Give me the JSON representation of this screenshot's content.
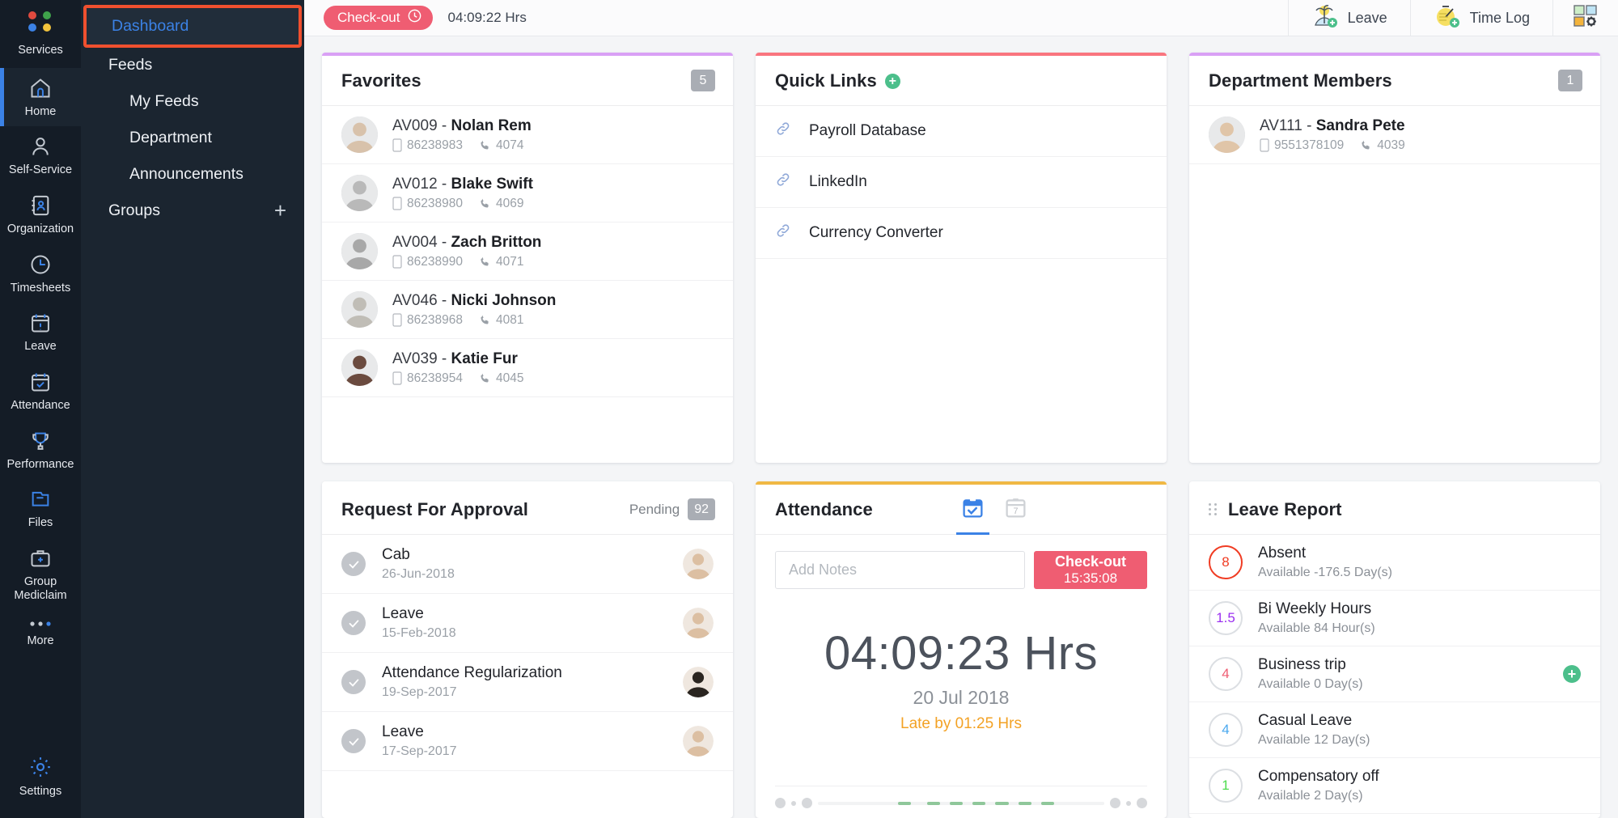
{
  "rail": {
    "items": [
      {
        "label": "Services",
        "icon": "dots-logo-icon",
        "active": false
      },
      {
        "label": "Home",
        "icon": "home-icon",
        "active": true
      },
      {
        "label": "Self-Service",
        "icon": "user-icon",
        "active": false
      },
      {
        "label": "Organization",
        "icon": "address-book-icon",
        "active": false
      },
      {
        "label": "Timesheets",
        "icon": "clock-icon",
        "active": false
      },
      {
        "label": "Leave",
        "icon": "calendar-alert-icon",
        "active": false
      },
      {
        "label": "Attendance",
        "icon": "calendar-check-icon",
        "active": false
      },
      {
        "label": "Performance",
        "icon": "trophy-icon",
        "active": false
      },
      {
        "label": "Files",
        "icon": "folder-icon",
        "active": false
      },
      {
        "label": "Group\nMediclaim",
        "icon": "briefcase-medical-icon",
        "active": false
      },
      {
        "label": "More",
        "icon": "ellipsis-icon",
        "active": false
      },
      {
        "label": "Settings",
        "icon": "gear-icon",
        "active": false
      }
    ]
  },
  "subnav": {
    "selected": "Dashboard",
    "items": [
      {
        "label": "Feeds",
        "indent": false,
        "plus": false
      },
      {
        "label": "My Feeds",
        "indent": true,
        "plus": false
      },
      {
        "label": "Department",
        "indent": true,
        "plus": false
      },
      {
        "label": "Announcements",
        "indent": true,
        "plus": false
      },
      {
        "label": "Groups",
        "indent": false,
        "plus": true
      }
    ]
  },
  "topbar": {
    "checkout_label": "Check-out",
    "hours": "04:09:22 Hrs",
    "leave_label": "Leave",
    "timelog_label": "Time Log"
  },
  "favorites": {
    "title": "Favorites",
    "count": "5",
    "accent": "#d9a0f5",
    "people": [
      {
        "code": "AV009 - ",
        "name": "Nolan Rem",
        "mobile": "86238983",
        "ext": "4074",
        "tone": "#d8c2ab"
      },
      {
        "code": "AV012 - ",
        "name": "Blake Swift",
        "mobile": "86238980",
        "ext": "4069",
        "tone": "#b9b9b9"
      },
      {
        "code": "AV004 - ",
        "name": "Zach Britton",
        "mobile": "86238990",
        "ext": "4071",
        "tone": "#a8a8a8"
      },
      {
        "code": "AV046 - ",
        "name": "Nicki Johnson",
        "mobile": "86238968",
        "ext": "4081",
        "tone": "#c0bdb6"
      },
      {
        "code": "AV039 - ",
        "name": "Katie Fur",
        "mobile": "86238954",
        "ext": "4045",
        "tone": "#6b4b3f"
      }
    ]
  },
  "quick_links": {
    "title": "Quick Links",
    "accent": "#f9757f",
    "links": [
      {
        "label": "Payroll Database"
      },
      {
        "label": "LinkedIn"
      },
      {
        "label": "Currency Converter"
      }
    ]
  },
  "department_members": {
    "title": "Department Members",
    "count": "1",
    "accent": "#d9a0f5",
    "people": [
      {
        "code": "AV111 - ",
        "name": "Sandra Pete",
        "mobile": "9551378109",
        "ext": "4039",
        "tone": "#e0c5a8"
      }
    ]
  },
  "approvals": {
    "title": "Request For Approval",
    "pending_label": "Pending",
    "pending_count": "92",
    "rows": [
      {
        "title": "Cab",
        "date": "26-Jun-2018",
        "tone": "#dcbfa2"
      },
      {
        "title": "Leave",
        "date": "15-Feb-2018",
        "tone": "#dcbfa2"
      },
      {
        "title": "Attendance Regularization",
        "date": "19-Sep-2017",
        "tone": "#2a2520"
      },
      {
        "title": "Leave",
        "date": "17-Sep-2017",
        "tone": "#dcbfa2"
      }
    ]
  },
  "attendance": {
    "title": "Attendance",
    "accent": "#f0b844",
    "tab_today_icon": "calendar-check-icon",
    "tab_week_icon": "calendar-7-icon",
    "notes_placeholder": "Add Notes",
    "checkout_label": "Check-out",
    "checkout_time": "15:35:08",
    "clock": "04:09:23 Hrs",
    "date": "20 Jul 2018",
    "late": "Late by 01:25 Hrs",
    "progress_segments": [
      28,
      38,
      46,
      54,
      62,
      70,
      78
    ]
  },
  "leave_report": {
    "title": "Leave Report",
    "rows": [
      {
        "value": "8",
        "name": "Absent",
        "sub": "Available -176.5 Day(s)",
        "color": "#f03c23",
        "ring": "#f03c23",
        "add": false
      },
      {
        "value": "1.5",
        "name": "Bi Weekly Hours",
        "sub": "Available 84 Hour(s)",
        "color": "#9b30f0",
        "ring": "#dcdfe3",
        "add": false
      },
      {
        "value": "4",
        "name": "Business trip",
        "sub": "Available 0 Day(s)",
        "color": "#ef5d72",
        "ring": "#dcdfe3",
        "add": true
      },
      {
        "value": "4",
        "name": "Casual Leave",
        "sub": "Available 12 Day(s)",
        "color": "#4aa8ef",
        "ring": "#dcdfe3",
        "add": false
      },
      {
        "value": "1",
        "name": "Compensatory off",
        "sub": "Available 2 Day(s)",
        "color": "#4ddb4d",
        "ring": "#dcdfe3",
        "add": false
      }
    ]
  }
}
